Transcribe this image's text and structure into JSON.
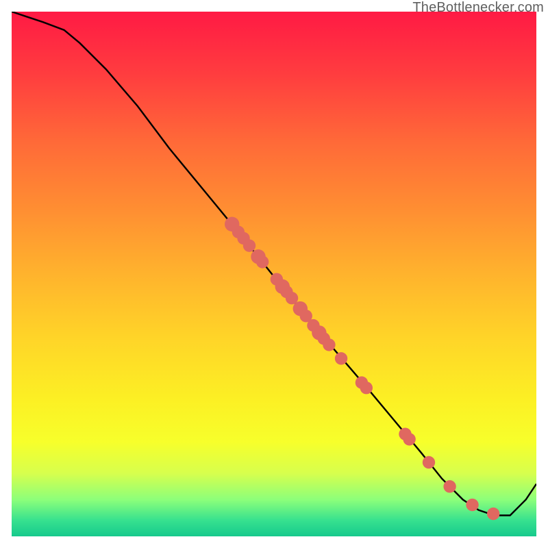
{
  "attribution": "TheBottlenecker.com",
  "chart_data": {
    "type": "line",
    "title": "",
    "xlabel": "",
    "ylabel": "",
    "xlim": [
      0,
      100
    ],
    "ylim": [
      0,
      100
    ],
    "series": [
      {
        "name": "curve",
        "x": [
          0,
          3,
          6,
          10,
          13,
          18,
          24,
          30,
          37,
          44,
          50,
          56,
          62,
          68,
          73,
          78,
          82,
          86,
          89,
          92,
          95,
          98,
          100
        ],
        "y": [
          100,
          99,
          98,
          96.5,
          94,
          89,
          82,
          74,
          65.5,
          57,
          49.5,
          42,
          35,
          28,
          22,
          16,
          11,
          7,
          5,
          4,
          4,
          7,
          10
        ]
      }
    ],
    "scatter": [
      {
        "x": 42.0,
        "y": 59.5,
        "r": 1.4
      },
      {
        "x": 43.2,
        "y": 58.0,
        "r": 1.2
      },
      {
        "x": 44.2,
        "y": 56.8,
        "r": 1.2
      },
      {
        "x": 45.3,
        "y": 55.4,
        "r": 1.2
      },
      {
        "x": 47.0,
        "y": 53.3,
        "r": 1.4
      },
      {
        "x": 47.8,
        "y": 52.3,
        "r": 1.2
      },
      {
        "x": 50.5,
        "y": 49.0,
        "r": 1.2
      },
      {
        "x": 51.6,
        "y": 47.6,
        "r": 1.4
      },
      {
        "x": 52.4,
        "y": 46.6,
        "r": 1.2
      },
      {
        "x": 53.4,
        "y": 45.4,
        "r": 1.2
      },
      {
        "x": 55.0,
        "y": 43.4,
        "r": 1.4
      },
      {
        "x": 56.1,
        "y": 42.0,
        "r": 1.2
      },
      {
        "x": 57.5,
        "y": 40.2,
        "r": 1.2
      },
      {
        "x": 58.6,
        "y": 38.8,
        "r": 1.4
      },
      {
        "x": 59.5,
        "y": 37.7,
        "r": 1.2
      },
      {
        "x": 60.5,
        "y": 36.5,
        "r": 1.2
      },
      {
        "x": 62.8,
        "y": 33.9,
        "r": 1.2
      },
      {
        "x": 66.7,
        "y": 29.3,
        "r": 1.2
      },
      {
        "x": 67.6,
        "y": 28.3,
        "r": 1.2
      },
      {
        "x": 75.0,
        "y": 19.5,
        "r": 1.2
      },
      {
        "x": 75.8,
        "y": 18.5,
        "r": 1.2
      },
      {
        "x": 79.5,
        "y": 14.1,
        "r": 1.2
      },
      {
        "x": 83.5,
        "y": 9.5,
        "r": 1.2
      },
      {
        "x": 87.8,
        "y": 6.0,
        "r": 1.2
      },
      {
        "x": 91.8,
        "y": 4.3,
        "r": 1.2
      }
    ],
    "scatter_color": "#e06860",
    "line_color": "#000000"
  }
}
